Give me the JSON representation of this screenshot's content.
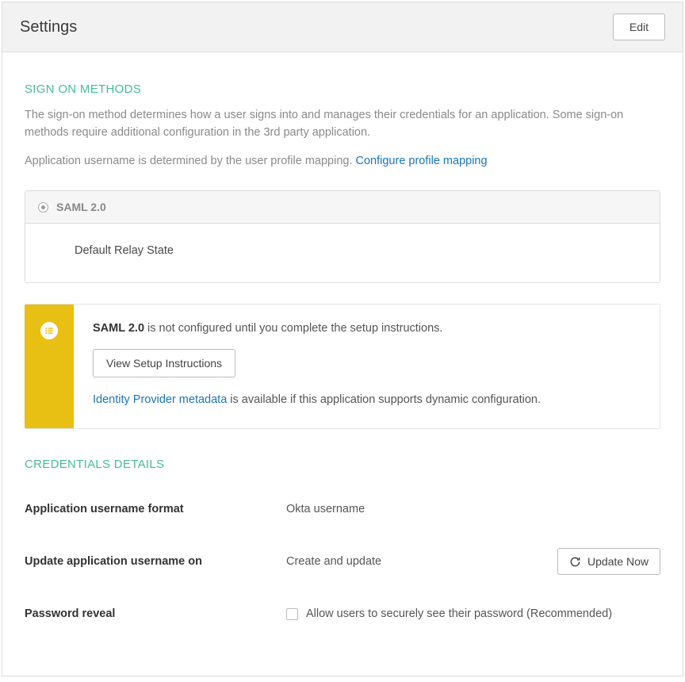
{
  "header": {
    "title": "Settings",
    "edit_label": "Edit"
  },
  "sign_on": {
    "title": "SIGN ON METHODS",
    "desc1": "The sign-on method determines how a user signs into and manages their credentials for an application. Some sign-on methods require additional configuration in the 3rd party application.",
    "desc2_prefix": "Application username is determined by the user profile mapping. ",
    "desc2_link": "Configure profile mapping",
    "card": {
      "method_label": "SAML 2.0",
      "field_label": "Default Relay State"
    }
  },
  "notice": {
    "strong": "SAML 2.0",
    "text_suffix": " is not configured until you complete the setup instructions.",
    "button_label": "View Setup Instructions",
    "link_text": "Identity Provider metadata",
    "link_suffix": " is available if this application supports dynamic configuration."
  },
  "credentials": {
    "title": "CREDENTIALS DETAILS",
    "rows": {
      "username_format": {
        "label": "Application username format",
        "value": "Okta username"
      },
      "update_on": {
        "label": "Update application username on",
        "value": "Create and update",
        "button": "Update Now"
      },
      "password_reveal": {
        "label": "Password reveal",
        "checkbox_label": "Allow users to securely see their password (Recommended)"
      }
    }
  }
}
